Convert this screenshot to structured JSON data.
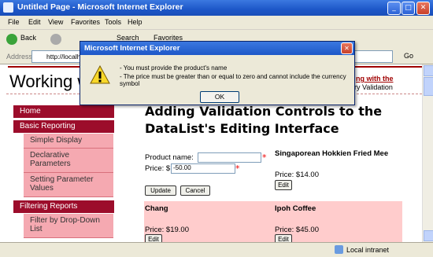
{
  "window": {
    "title": "Untitled Page - Microsoft Internet Explorer"
  },
  "menu": [
    "File",
    "Edit",
    "View",
    "Favorites",
    "Tools",
    "Help"
  ],
  "toolbar": {
    "back": "Back",
    "search": "Search",
    "favorites": "Favorites"
  },
  "address": {
    "label": "Address",
    "url": "http://localho",
    "go": "Go"
  },
  "site": {
    "title": "Working w",
    "right_link": "ng with the",
    "right_text": "ry Validation"
  },
  "nav": {
    "items": [
      {
        "label": "Home",
        "kind": "head"
      },
      {
        "label": "Basic Reporting",
        "kind": "head"
      },
      {
        "label": "Simple Display",
        "kind": "sub"
      },
      {
        "label": "Declarative Parameters",
        "kind": "sub"
      },
      {
        "label": "Setting Parameter Values",
        "kind": "sub"
      },
      {
        "label": "Filtering Reports",
        "kind": "head"
      },
      {
        "label": "Filter by Drop-Down List",
        "kind": "sub"
      }
    ]
  },
  "main": {
    "heading_line1": "Adding Validation Controls to the",
    "heading_line2": "DataList's Editing Interface",
    "edit": {
      "product_label": "Product name:",
      "product_value": "",
      "price_label": "Price: $",
      "price_value": "-50.00",
      "update_label": "Update",
      "cancel_label": "Cancel"
    },
    "products": [
      {
        "name": "Singaporean Hokkien Fried Mee",
        "price": "Price: $14.00",
        "edit": "Edit"
      },
      {
        "name": "Chang",
        "price": "Price: $19.00",
        "edit": "Edit"
      },
      {
        "name": "Ipoh Coffee",
        "price": "Price: $45.00",
        "edit": "Edit"
      }
    ],
    "required_marker": "*"
  },
  "status": {
    "zone": "Local intranet"
  },
  "dialog": {
    "title": "Microsoft Internet Explorer",
    "line1": "- You must provide the product's name",
    "line2": "- The price must be greater than or equal to zero and cannot include the currency symbol",
    "ok": "OK"
  },
  "colors": {
    "nav_head": "#9c0d2b",
    "nav_sub": "#f5a9b1",
    "row_highlight": "#ffcccc",
    "accent_red": "#a00000"
  }
}
